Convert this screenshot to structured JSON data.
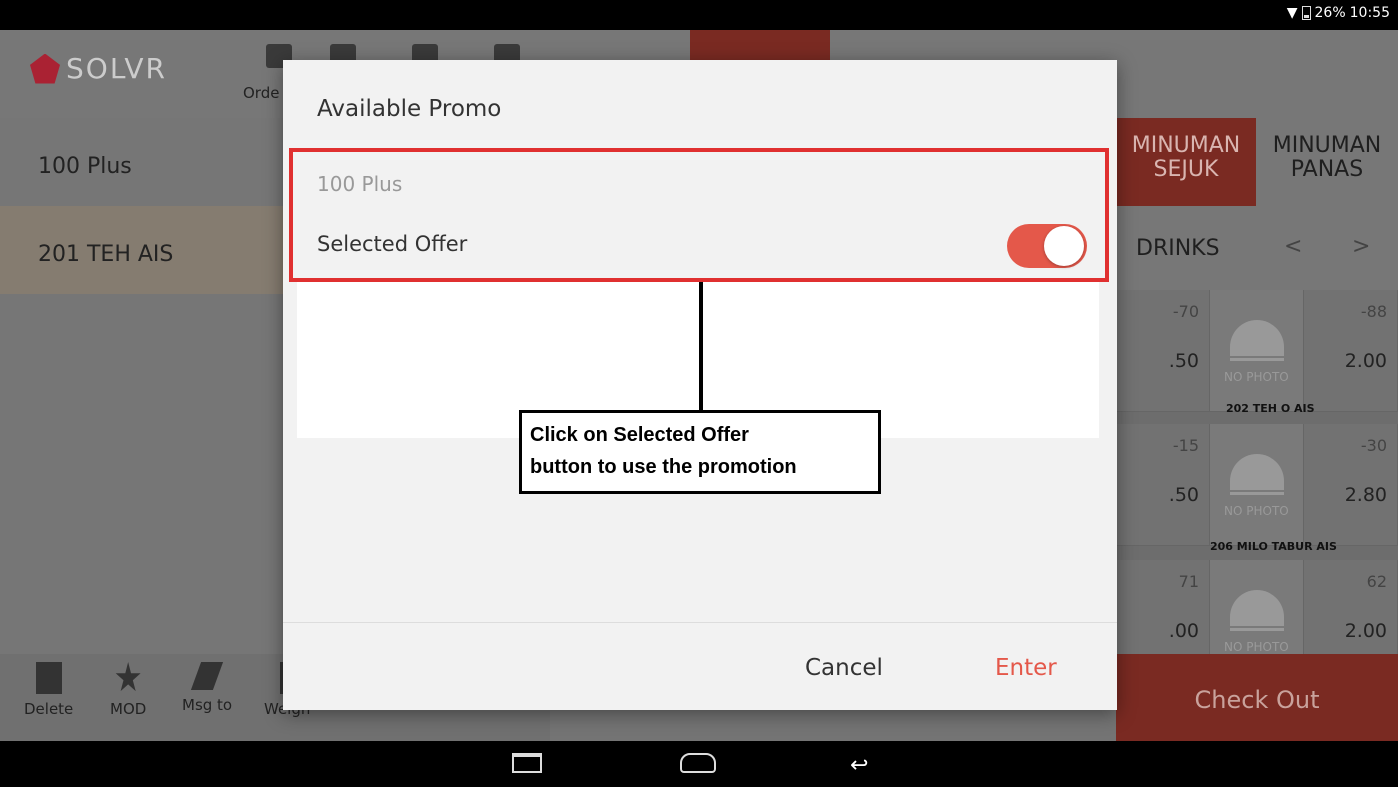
{
  "status_bar": {
    "battery": "26%",
    "time": "10:55"
  },
  "app": {
    "logo_text": "SOLVR",
    "header_label": "Orde"
  },
  "order_list": {
    "items": [
      {
        "label": "100 Plus"
      },
      {
        "label": "201 TEH AIS"
      }
    ]
  },
  "categories": [
    {
      "label": "MINUMAN SEJUK"
    },
    {
      "label": "MINUMAN PANAS"
    }
  ],
  "subcategory": {
    "label": "DRINKS",
    "prev": "<",
    "next": ">"
  },
  "menu_cells": [
    {
      "code": "-70",
      "price": ".50"
    },
    {
      "code": "-88",
      "price": "2.00"
    },
    {
      "code": "-15",
      "price": ".50"
    },
    {
      "code": "-30",
      "price": "2.80"
    },
    {
      "code": "71",
      "price": ".00"
    },
    {
      "code": "62",
      "price": "2.00"
    }
  ],
  "menu_names": [
    "202 TEH O AIS",
    "206 MILO TABUR AIS"
  ],
  "no_photo": "NO PHOTO",
  "tools": [
    {
      "label": "Delete"
    },
    {
      "label": "MOD"
    },
    {
      "label": "Msg to"
    },
    {
      "label": "Weigh"
    }
  ],
  "checkout": "Check Out",
  "dialog": {
    "title": "Available Promo",
    "promo_name": "100 Plus",
    "offer_label": "Selected Offer",
    "toggle_on": true,
    "cancel_label": "Cancel",
    "enter_label": "Enter"
  },
  "annotation": {
    "line1": "Click on Selected Offer",
    "line2": "button to use the promotion"
  },
  "colors": {
    "accent": "#e4584a",
    "highlight_border": "#e03030"
  }
}
